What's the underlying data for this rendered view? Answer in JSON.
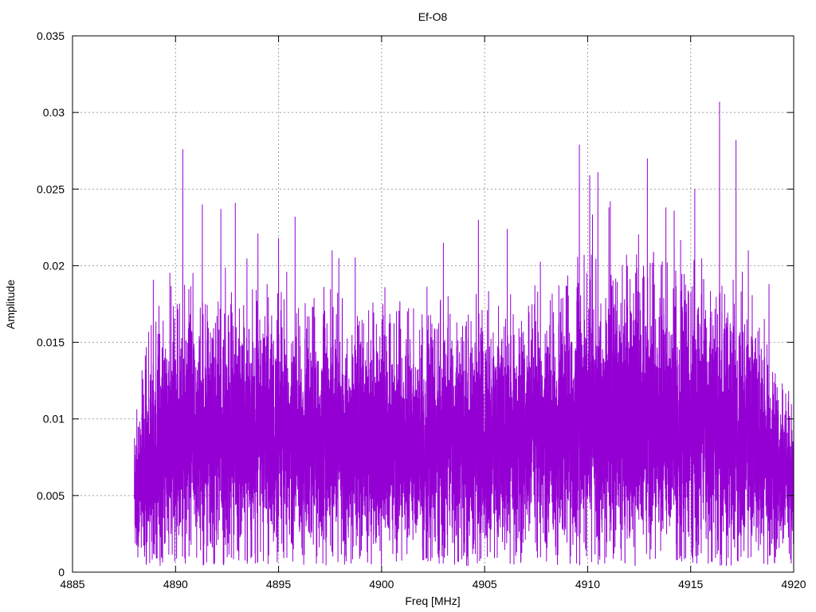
{
  "chart_data": {
    "type": "line",
    "title": "Ef-O8",
    "xlabel": "Freq [MHz]",
    "ylabel": "Amplitude",
    "xlim": [
      4885,
      4920
    ],
    "ylim": [
      0,
      0.035
    ],
    "x_ticks": [
      "4885",
      "4890",
      "4895",
      "4900",
      "4905",
      "4910",
      "4915",
      "4920"
    ],
    "y_ticks": [
      "0",
      "0.005",
      "0.01",
      "0.015",
      "0.02",
      "0.025",
      "0.03",
      "0.035"
    ],
    "grid": true,
    "legend": "none",
    "series": [
      {
        "color": "#9400d3",
        "x_range": [
          4888.0,
          4920.0
        ],
        "n_points": 9000,
        "envelope_x": [
          4888.0,
          4889.0,
          4890.0,
          4891.0,
          4892.0,
          4893.0,
          4894.0,
          4895.0,
          4896.0,
          4897.0,
          4898.0,
          4899.0,
          4900.0,
          4901.0,
          4902.0,
          4903.0,
          4904.0,
          4905.0,
          4906.0,
          4907.0,
          4908.0,
          4909.0,
          4910.0,
          4911.0,
          4912.0,
          4913.0,
          4914.0,
          4915.0,
          4916.0,
          4917.0,
          4918.0,
          4919.0,
          4920.0
        ],
        "envelope_mean": [
          0.0055,
          0.0075,
          0.0085,
          0.0088,
          0.0088,
          0.0087,
          0.0086,
          0.0085,
          0.0084,
          0.0083,
          0.0082,
          0.0082,
          0.0081,
          0.0081,
          0.0081,
          0.0082,
          0.0083,
          0.0084,
          0.0085,
          0.0086,
          0.0088,
          0.009,
          0.0093,
          0.0095,
          0.0096,
          0.0096,
          0.0095,
          0.0094,
          0.0093,
          0.0092,
          0.0088,
          0.007,
          0.005
        ],
        "peaks": [
          {
            "x": 4890.35,
            "y": 0.0276
          },
          {
            "x": 4891.3,
            "y": 0.024
          },
          {
            "x": 4892.2,
            "y": 0.0237
          },
          {
            "x": 4892.9,
            "y": 0.0241
          },
          {
            "x": 4894.0,
            "y": 0.0221
          },
          {
            "x": 4895.0,
            "y": 0.0218
          },
          {
            "x": 4895.8,
            "y": 0.0232
          },
          {
            "x": 4897.6,
            "y": 0.021
          },
          {
            "x": 4903.0,
            "y": 0.0215
          },
          {
            "x": 4904.7,
            "y": 0.023
          },
          {
            "x": 4906.1,
            "y": 0.0224
          },
          {
            "x": 4909.6,
            "y": 0.0279
          },
          {
            "x": 4910.1,
            "y": 0.0259
          },
          {
            "x": 4910.5,
            "y": 0.0261
          },
          {
            "x": 4911.1,
            "y": 0.0242
          },
          {
            "x": 4912.9,
            "y": 0.027
          },
          {
            "x": 4913.8,
            "y": 0.0238
          },
          {
            "x": 4914.2,
            "y": 0.0236
          },
          {
            "x": 4915.2,
            "y": 0.025
          },
          {
            "x": 4916.4,
            "y": 0.0307
          },
          {
            "x": 4917.2,
            "y": 0.0282
          },
          {
            "x": 4917.8,
            "y": 0.021
          },
          {
            "x": 4918.8,
            "y": 0.0188
          }
        ]
      }
    ]
  }
}
